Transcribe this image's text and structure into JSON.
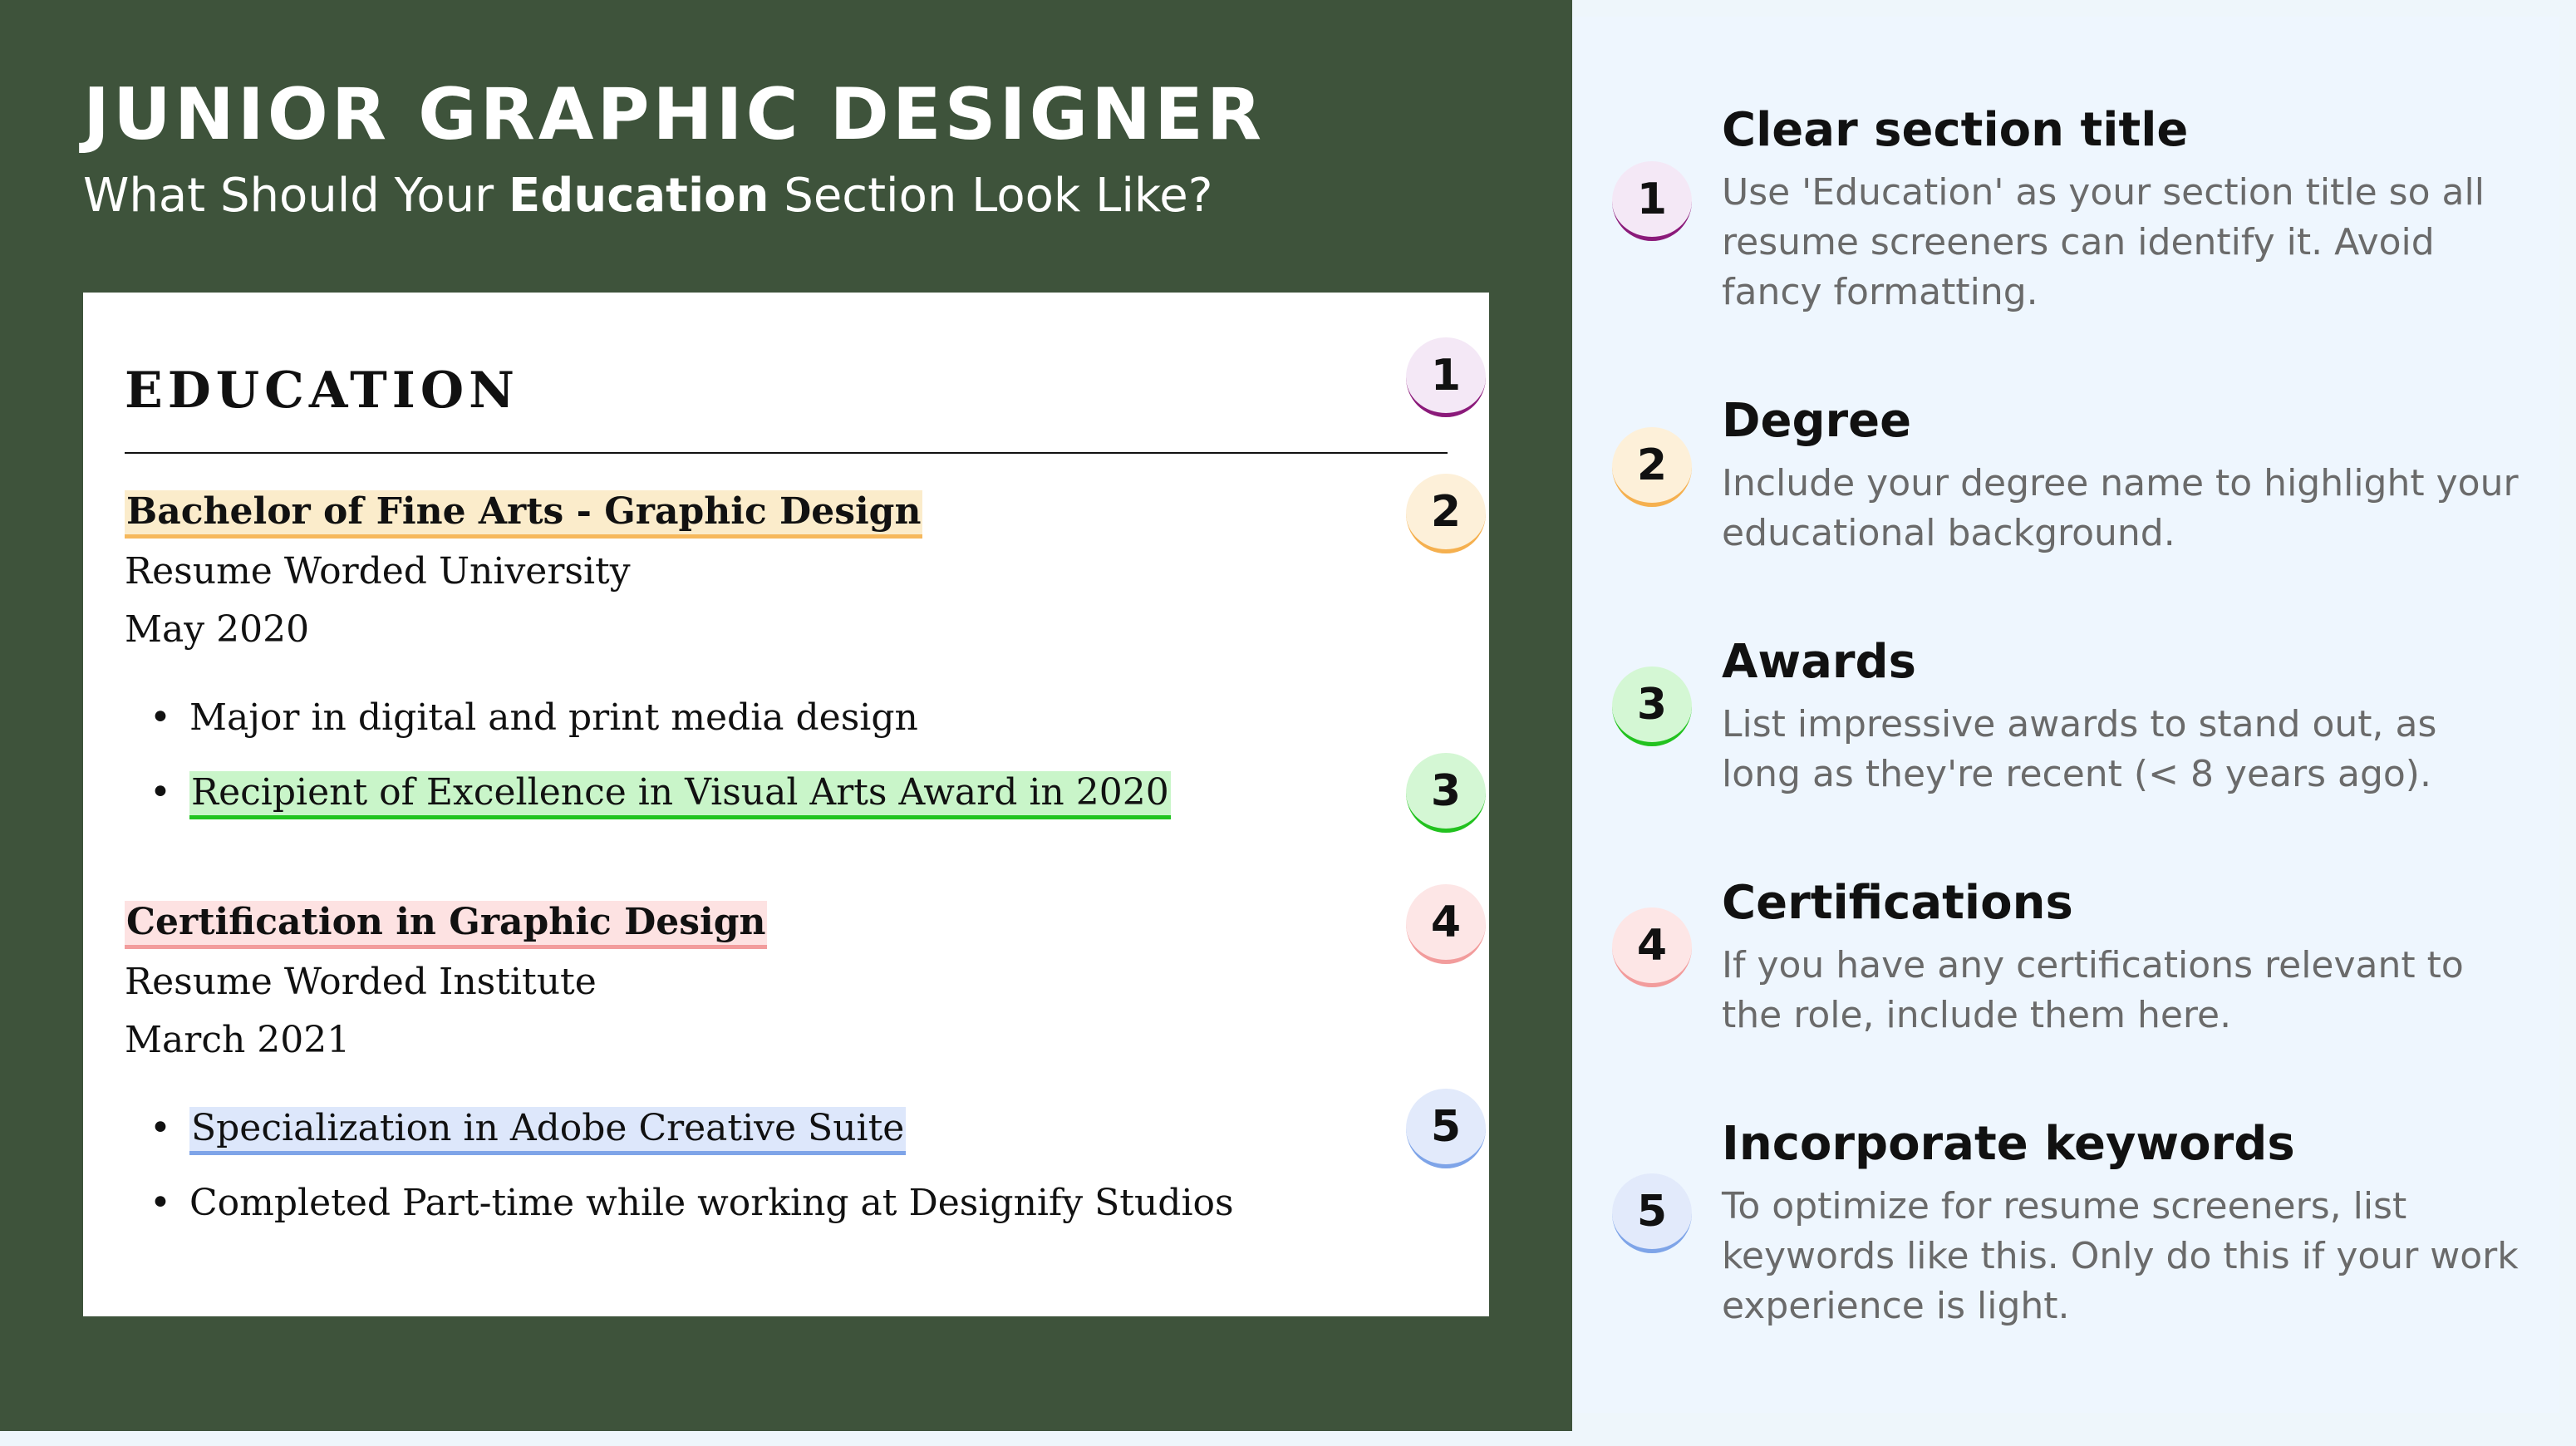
{
  "header": {
    "title": "JUNIOR GRAPHIC DESIGNER",
    "subtitle_prefix": "What Should Your ",
    "subtitle_bold": "Education",
    "subtitle_suffix": " Section Look Like?"
  },
  "resume": {
    "section_title": "EDUCATION",
    "entries": [
      {
        "degree": "Bachelor of Fine Arts - Graphic Design",
        "institution": "Resume Worded University",
        "date": "May 2020",
        "bullets": [
          "Major in digital and print media design",
          "Recipient of Excellence in Visual Arts Award in 2020"
        ]
      },
      {
        "degree": "Certification in Graphic Design",
        "institution": "Resume Worded Institute",
        "date": "March 2021",
        "bullets": [
          "Specialization in Adobe Creative Suite",
          "Completed Part-time while working at Designify Studios"
        ]
      }
    ],
    "badges": [
      "1",
      "2",
      "3",
      "4",
      "5"
    ]
  },
  "tips": [
    {
      "number": "1",
      "title": "Clear section title",
      "text": "Use 'Education' as your section title so all resume screeners can identify it. Avoid fancy formatting."
    },
    {
      "number": "2",
      "title": "Degree",
      "text": "Include your degree name to highlight your educational background."
    },
    {
      "number": "3",
      "title": "Awards",
      "text": "List impressive awards to stand out, as long as they're recent (< 8 years ago)."
    },
    {
      "number": "4",
      "title": "Certifications",
      "text": "If you have any certifications relevant to the role, include them here."
    },
    {
      "number": "5",
      "title": "Incorporate keywords",
      "text": "To optimize for resume screeners, list keywords like this. Only do this if your work experience is light."
    }
  ],
  "colors": {
    "background_green": "#3e533b",
    "tips_panel": "#eef6fe",
    "badge_1": "#8b1a7a",
    "badge_2": "#f5b04f",
    "badge_3": "#22c21f",
    "badge_4": "#f29c9c",
    "badge_5": "#7ea4e8"
  }
}
